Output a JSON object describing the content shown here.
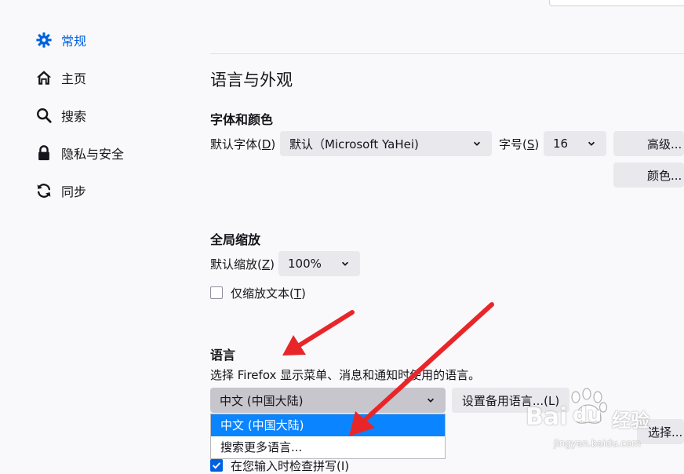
{
  "sidebar": {
    "items": [
      {
        "label": "常规",
        "icon": "gear-icon",
        "active": true
      },
      {
        "label": "主页",
        "icon": "home-icon",
        "active": false
      },
      {
        "label": "搜索",
        "icon": "search-icon",
        "active": false
      },
      {
        "label": "隐私与安全",
        "icon": "lock-icon",
        "active": false
      },
      {
        "label": "同步",
        "icon": "sync-icon",
        "active": false
      }
    ]
  },
  "main": {
    "title": "语言与外观",
    "fonts": {
      "heading": "字体和颜色",
      "default_font_label_pre": "默认字体(",
      "default_font_key": "D",
      "default_font_label_post": ")",
      "default_font_value": "默认（Microsoft YaHei)",
      "size_label_pre": "字号(",
      "size_key": "S",
      "size_label_post": ")",
      "size_value": "16",
      "advanced_button": "高级...",
      "colors_button": "颜色..."
    },
    "zoom": {
      "heading": "全局缩放",
      "default_zoom_label_pre": "默认缩放(",
      "default_zoom_key": "Z",
      "default_zoom_label_post": ")",
      "default_zoom_value": "100%",
      "zoom_text_only_pre": "仅缩放文本(",
      "zoom_text_only_key": "T",
      "zoom_text_only_post": ")",
      "zoom_text_only_checked": false
    },
    "language": {
      "heading": "语言",
      "description": "选择 Firefox 显示菜单、消息和通知时使用的语言。",
      "selected_value": "中文 (中国大陆)",
      "alternatives_button": "设置备用语言...(L)",
      "options": [
        "中文 (中国大陆)",
        "搜索更多语言..."
      ],
      "choose_button": "选择...",
      "spellcheck_partial": "在您输入时检查拼写(I)",
      "spellcheck_checked": true
    }
  },
  "watermark": {
    "brand": "Bai",
    "brand2": "du",
    "cn": "经验",
    "url": "jingyan.baidu.com"
  },
  "colors": {
    "accent": "#0061e0",
    "dropdown_selected": "#0a84ff",
    "arrow": "#e8262a"
  }
}
